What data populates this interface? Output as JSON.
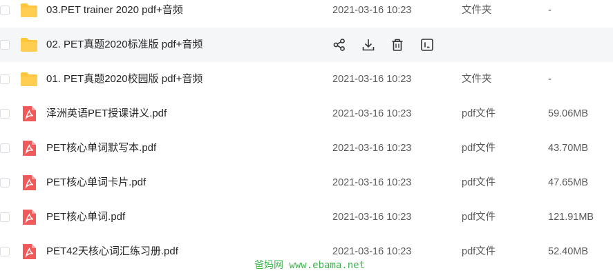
{
  "files": [
    {
      "name": "03.PET trainer 2020 pdf+音频",
      "date": "2021-03-16 10:23",
      "type": "文件夹",
      "size": "-",
      "kind": "folder",
      "hover": false
    },
    {
      "name": "02. PET真题2020标准版 pdf+音频",
      "date": "",
      "type": "",
      "size": "",
      "kind": "folder",
      "hover": true
    },
    {
      "name": "01. PET真题2020校园版 pdf+音频",
      "date": "2021-03-16 10:23",
      "type": "文件夹",
      "size": "-",
      "kind": "folder",
      "hover": false
    },
    {
      "name": "泽洲英语PET授课讲义.pdf",
      "date": "2021-03-16 10:23",
      "type": "pdf文件",
      "size": "59.06MB",
      "kind": "pdf",
      "hover": false
    },
    {
      "name": "PET核心单词默写本.pdf",
      "date": "2021-03-16 10:23",
      "type": "pdf文件",
      "size": "43.70MB",
      "kind": "pdf",
      "hover": false
    },
    {
      "name": "PET核心单词卡片.pdf",
      "date": "2021-03-16 10:23",
      "type": "pdf文件",
      "size": "47.65MB",
      "kind": "pdf",
      "hover": false
    },
    {
      "name": "PET核心单词.pdf",
      "date": "2021-03-16 10:23",
      "type": "pdf文件",
      "size": "121.91MB",
      "kind": "pdf",
      "hover": false
    },
    {
      "name": "PET42天核心词汇练习册.pdf",
      "date": "2021-03-16 10:23",
      "type": "pdf文件",
      "size": "52.40MB",
      "kind": "pdf",
      "hover": false
    }
  ],
  "hover_actions": [
    "share-icon",
    "download-icon",
    "delete-icon",
    "more-icon"
  ],
  "watermark": "爸妈网 www.ebama.net",
  "colors": {
    "folder": "#ffc53d",
    "pdf": "#f05a5a",
    "hover_bg": "#f5f6f8",
    "watermark": "#3fb34f"
  }
}
